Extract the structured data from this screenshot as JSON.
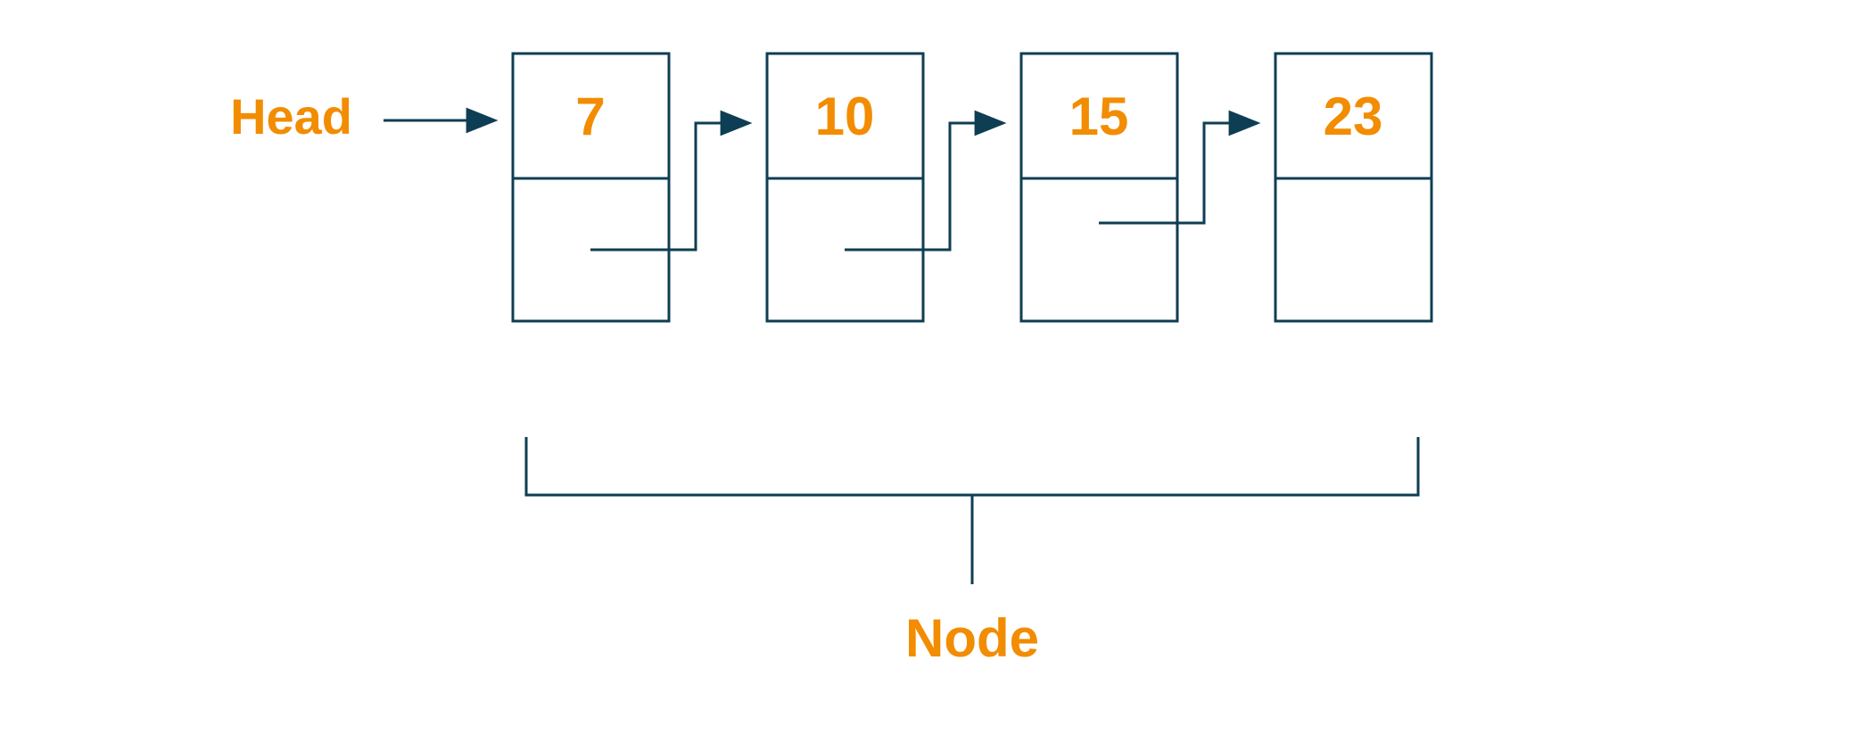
{
  "labels": {
    "head": "Head",
    "node": "Node"
  },
  "nodes": [
    {
      "value": "7"
    },
    {
      "value": "10"
    },
    {
      "value": "15"
    },
    {
      "value": "23"
    }
  ],
  "colors": {
    "accent": "#f28c00",
    "line": "#0e3e53"
  }
}
